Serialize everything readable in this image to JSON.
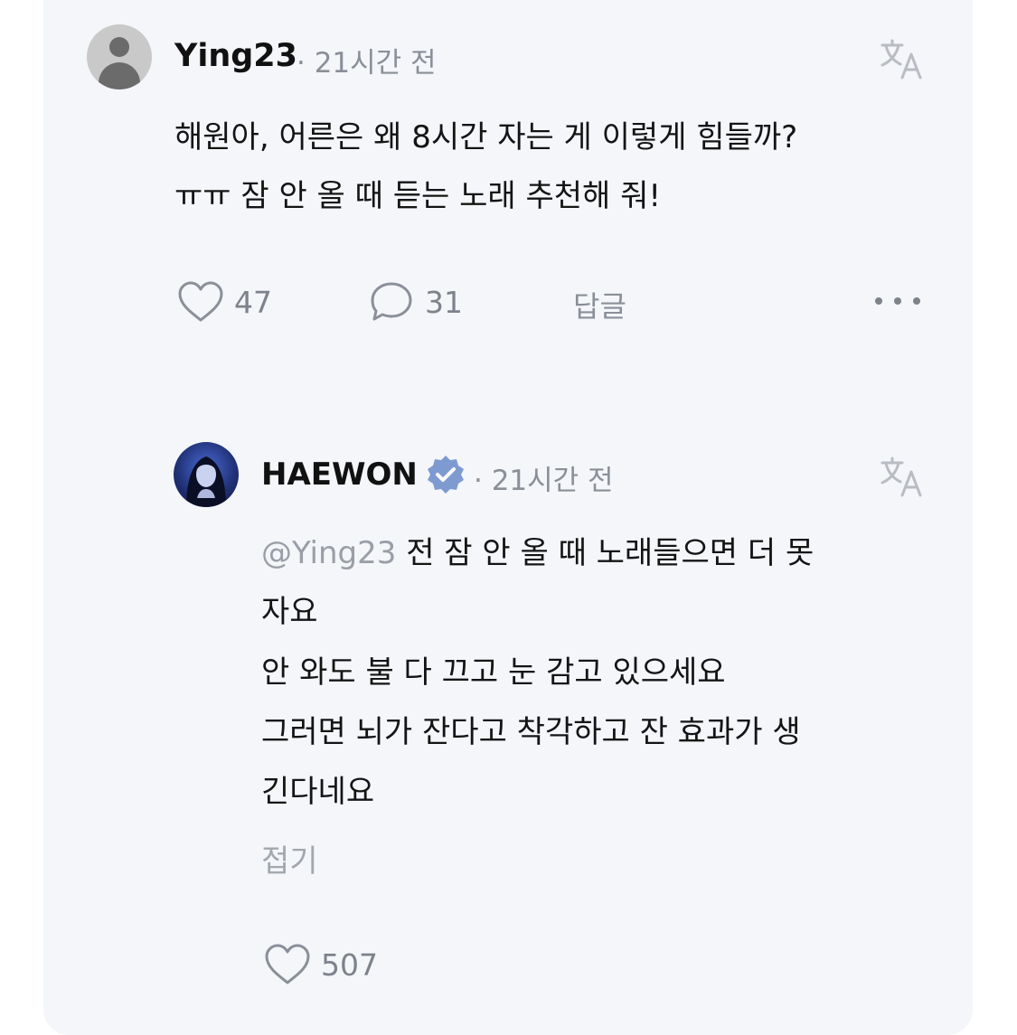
{
  "colors": {
    "card_bg": "#f4f6fa",
    "verified_badge": "#7e9bd1",
    "text": "#141414",
    "muted": "#8a8f98"
  },
  "comment": {
    "username": "Ying23",
    "time": "· 21시간 전",
    "avatar_icon": "default-user-avatar",
    "lines": [
      "해원아, 어른은 왜 8시간 자는 게 이렇게 힘들까?",
      "ㅠㅠ 잠 안 올 때 듣는 노래 추천해 줘!"
    ],
    "likes": "47",
    "comments": "31",
    "reply_label": "답글",
    "translate_icon": "translate-icon",
    "more_icon": "more-dots-icon"
  },
  "reply": {
    "username": "HAEWON",
    "verified_icon": "verified-badge-icon",
    "time": "· 21시간 전",
    "mention": "@Ying23",
    "lines": [
      " 전 잠 안 올 때 노래들으면 더 못",
      "자요",
      "안 와도 불 다 끄고 눈 감고 있으세요",
      "그러면 뇌가 잔다고 착각하고 잔 효과가 생",
      "긴다네요"
    ],
    "fold_label": "접기",
    "likes": "507"
  }
}
